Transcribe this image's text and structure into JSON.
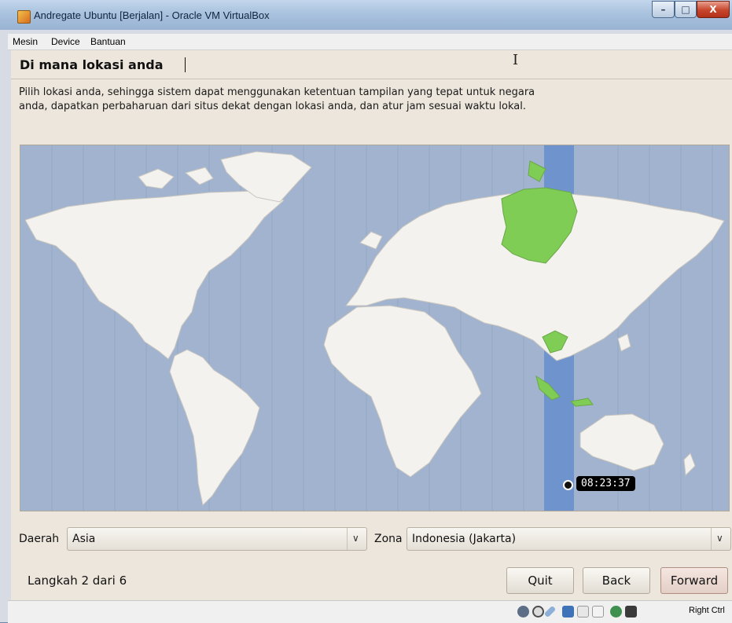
{
  "window": {
    "title": "Andregate Ubuntu [Berjalan] - Oracle VM VirtualBox",
    "minimize_glyph": "–",
    "maximize_glyph": "□",
    "close_glyph": "X"
  },
  "menubar": {
    "items": [
      "Mesin",
      "Device",
      "Bantuan"
    ]
  },
  "installer": {
    "heading": "Di mana lokasi anda",
    "description": "Pilih lokasi anda, sehingga sistem dapat menggunakan ketentuan tampilan yang tepat untuk negara anda, dapatkan perbaharuan dari situs dekat dengan lokasi anda, dan atur jam sesuai waktu lokal.",
    "map": {
      "time_tooltip": "08:23:37",
      "colors": {
        "ocean": "#a1b3ce",
        "land": "#f4f2ee",
        "selected_zone": "#7fcd55",
        "zone_band": "#6f93cc"
      }
    },
    "region_label": "Daerah",
    "region_value": "Asia",
    "zone_label": "Zona",
    "zone_value": "Indonesia (Jakarta)",
    "step_text": "Langkah 2 dari 6",
    "buttons": {
      "quit": "Quit",
      "back": "Back",
      "forward": "Forward"
    }
  },
  "statusbar": {
    "icons": [
      "hard-disk-icon",
      "cd-icon",
      "usb-icon",
      "network-icon",
      "shared-folder-icon",
      "display-icon",
      "capture-icon",
      "mouse-integration-icon"
    ],
    "host_key": "Right Ctrl"
  }
}
